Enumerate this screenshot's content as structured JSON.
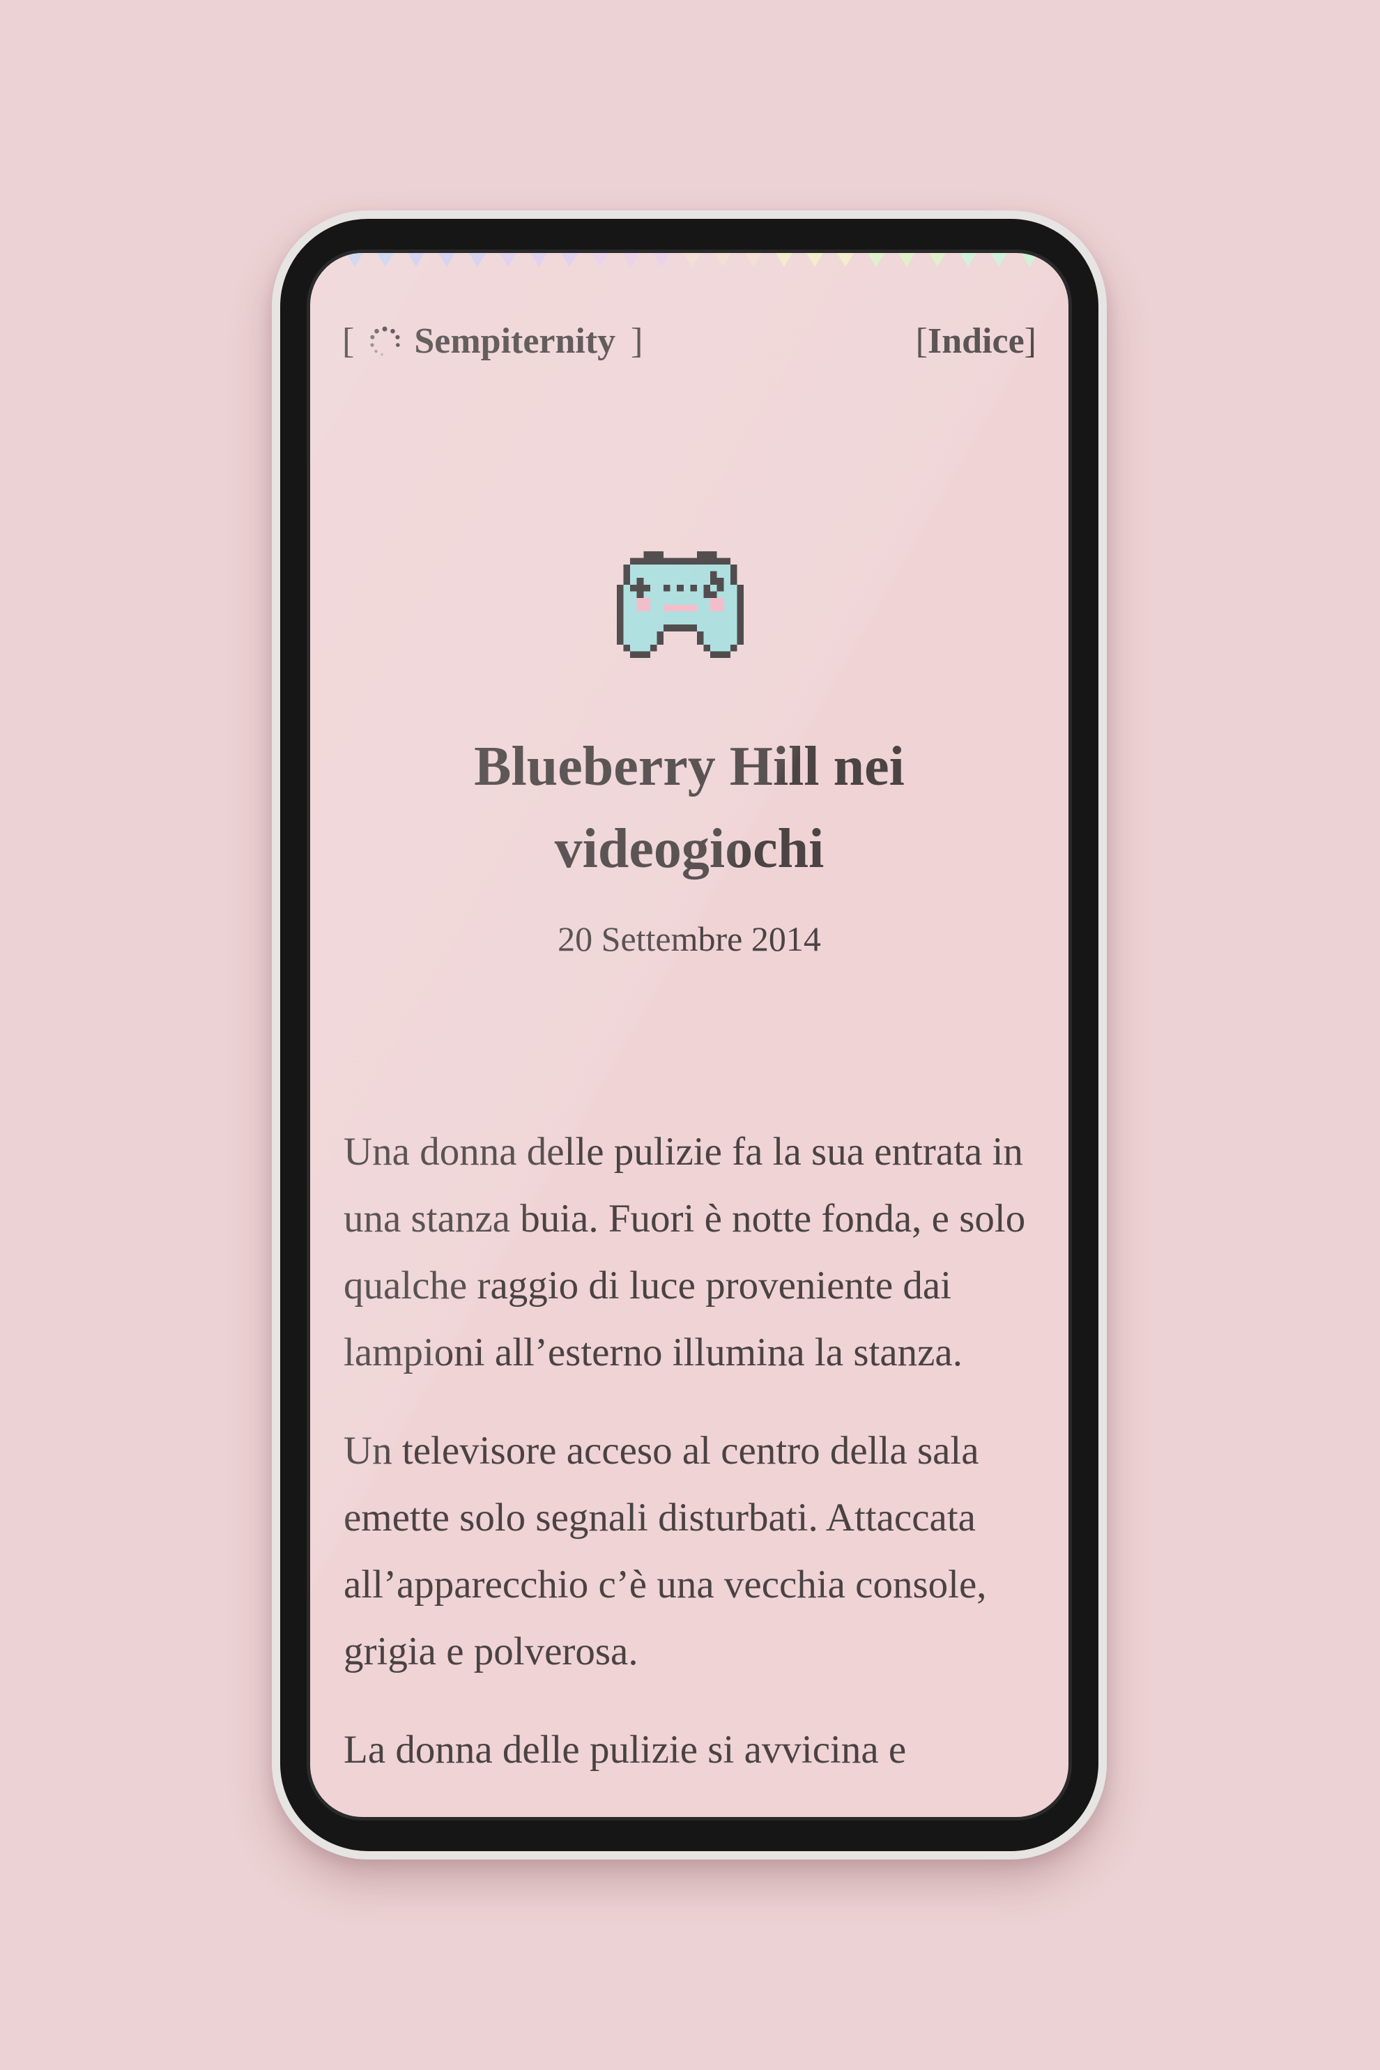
{
  "header": {
    "brand_open": "[",
    "brand_name": "Sempiternity",
    "brand_close": "]",
    "nav_open": "[",
    "nav_label": "Indice",
    "nav_close": "]"
  },
  "icons": {
    "brand": "loading-spinner-icon",
    "hero": "game-controller-icon"
  },
  "post": {
    "title": "Blueberry Hill nei videogiochi",
    "date": "20 Settembre 2014",
    "paragraphs": [
      "Una donna delle pulizie fa la sua entrata in una stanza buia. Fuori è notte fonda, e solo qualche raggio di luce proveniente dai lampioni all’esterno illumina la stanza.",
      "Un televisore acceso al centro della sala emette solo segnali disturbati. Attaccata all’apparecchio c’è una vecchia console, grigia e polverosa.",
      "La donna delle pulizie si avvicina e"
    ]
  },
  "colors": {
    "page_background": "#ecd2d4",
    "screen_background": "#efd3d5",
    "text": "#4b4344",
    "controller_accent": "#a8dcdc",
    "controller_pink": "#f2b7c4",
    "device_frame": "#161616"
  }
}
